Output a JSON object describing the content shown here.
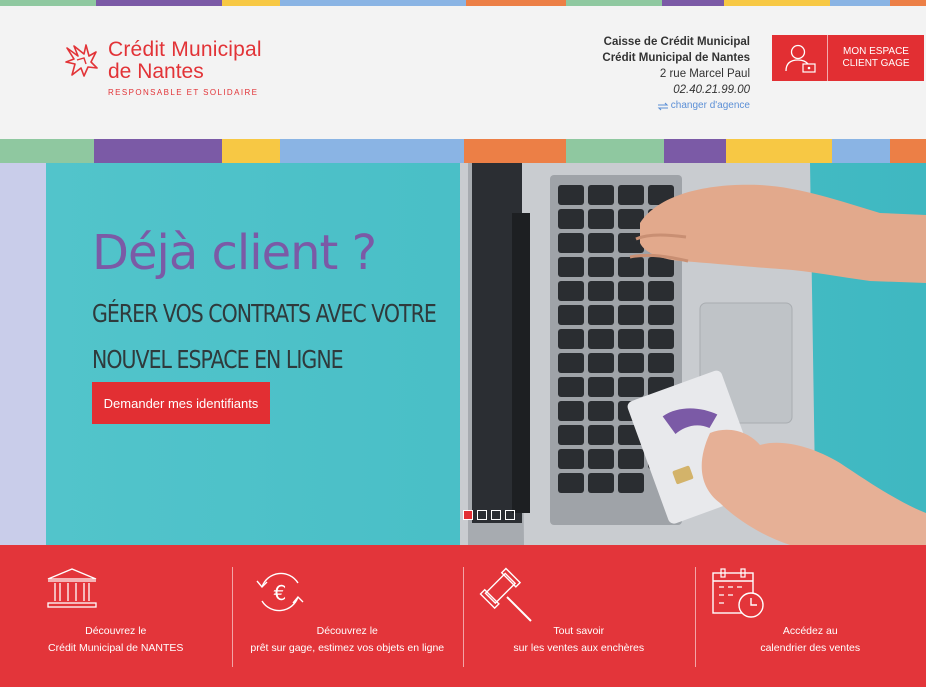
{
  "colors": {
    "brand_red": "#e22f33",
    "purple": "#7b5aa6",
    "teal": "#48c1c7",
    "stripe": [
      "#8fc8a0",
      "#7b5aa6",
      "#f7c844",
      "#8ab4e4",
      "#ec7f46",
      "#8fc8a0",
      "#7b5aa6",
      "#f7c844",
      "#8ab4e4",
      "#ec7f46"
    ]
  },
  "logo": {
    "line1": "Crédit Municipal",
    "line2": "de Nantes",
    "tagline": "RESPONSABLE ET SOLIDAIRE",
    "icon": "griffin-logo-icon"
  },
  "agency": {
    "line1": "Caisse de Crédit Municipal",
    "line2": "Crédit Municipal de Nantes",
    "address": "2 rue Marcel Paul",
    "phone": "02.40.21.99.00",
    "change_label": "changer d'agence"
  },
  "client_button": {
    "line1": "MON ESPACE",
    "line2": "CLIENT GAGE",
    "icon": "user-account-icon"
  },
  "hero": {
    "title": "Déjà client ?",
    "subtitle1": "GÉRER VOS CONTRATS AVEC VOTRE",
    "subtitle2": "NOUVEL ESPACE EN LIGNE",
    "cta": "Demander mes identifiants",
    "slides": 4,
    "active_slide": 1
  },
  "features": [
    {
      "line1": "Découvrez le",
      "line2": "Crédit Municipal de NANTES",
      "icon": "bank-building-icon"
    },
    {
      "line1": "Découvrez le",
      "line2": "prêt sur gage, estimez vos objets en ligne",
      "icon": "euro-exchange-icon"
    },
    {
      "line1": "Tout savoir",
      "line2": "sur les ventes aux enchères",
      "icon": "auction-gavel-icon"
    },
    {
      "line1": "Accédez au",
      "line2": "calendrier des ventes",
      "icon": "calendar-clock-icon"
    }
  ]
}
